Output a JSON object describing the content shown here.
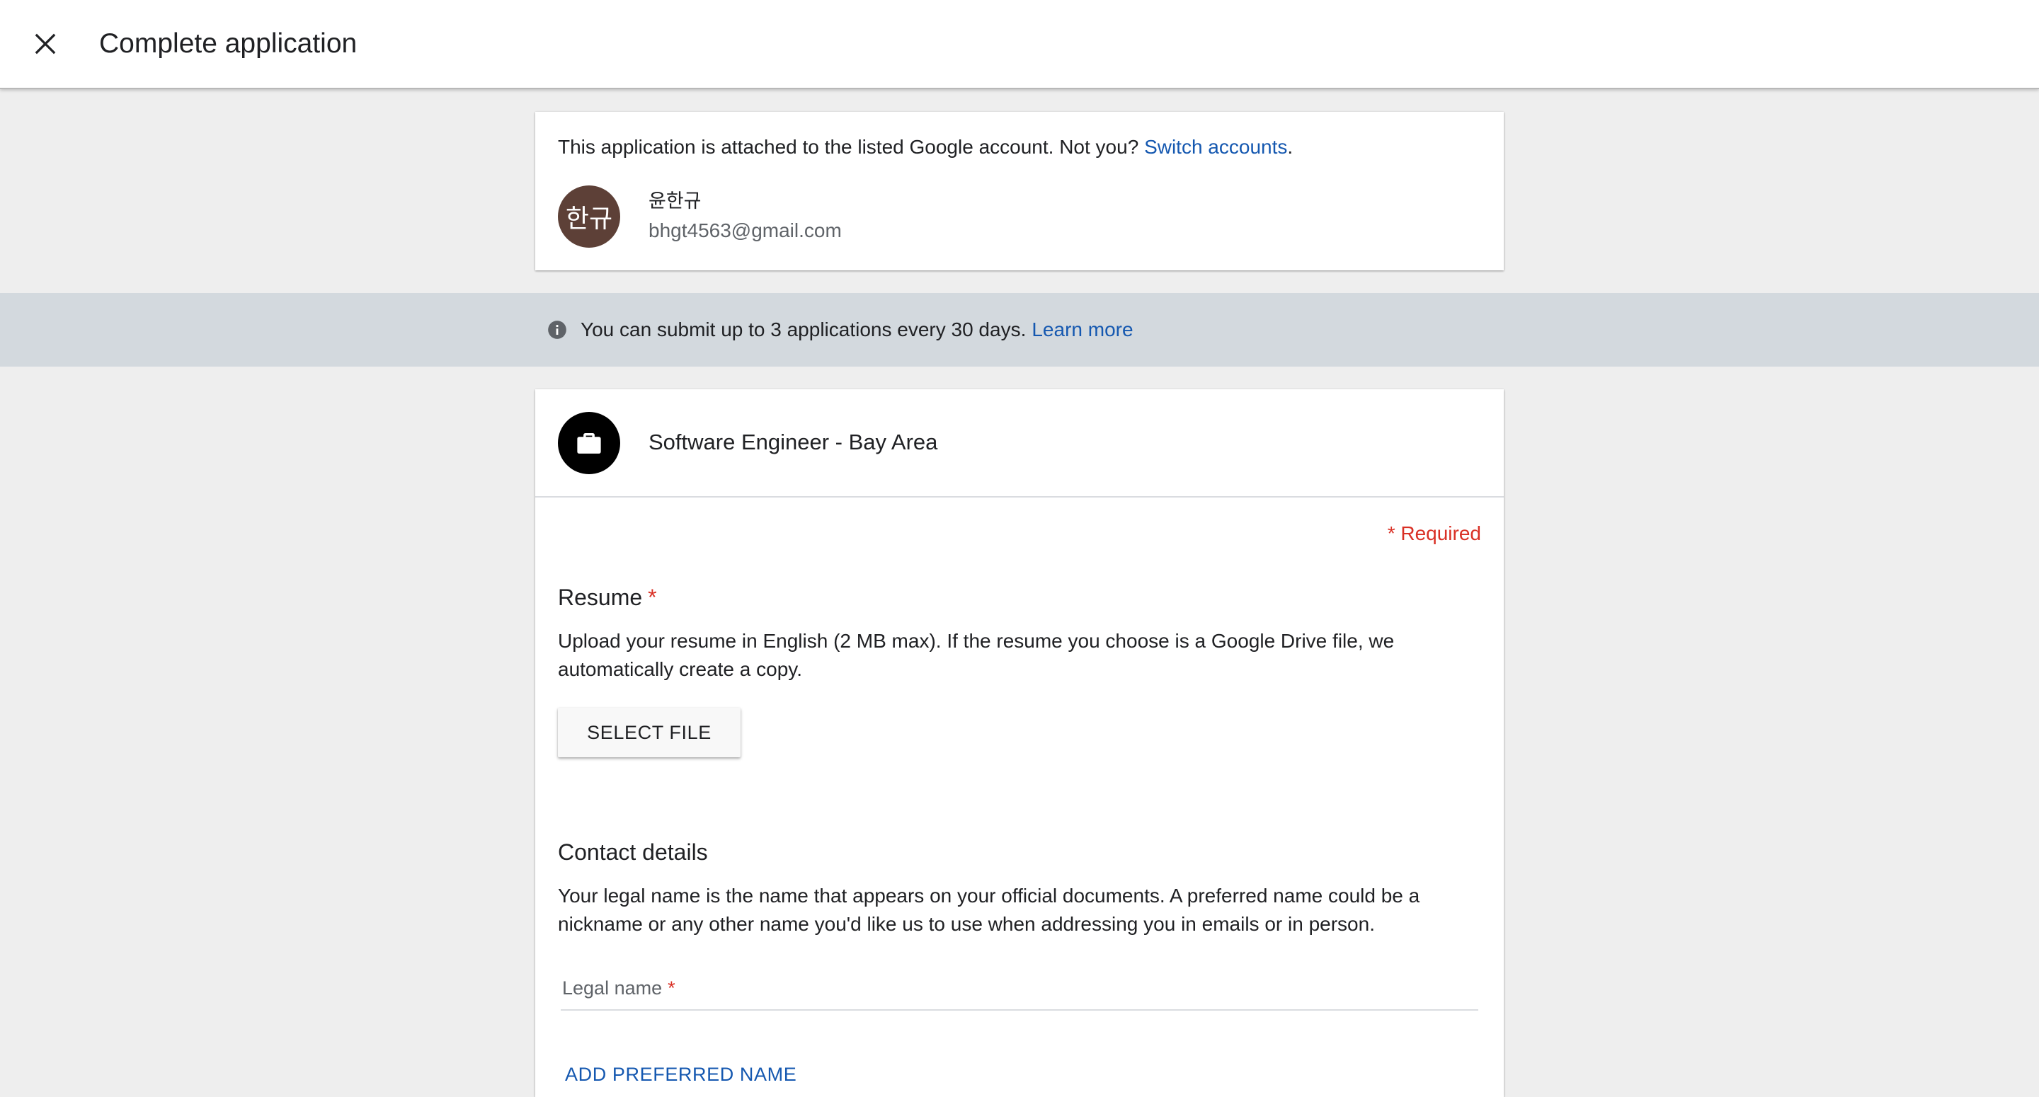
{
  "header": {
    "title": "Complete application",
    "close_icon": "close-icon"
  },
  "account": {
    "message": "This application is attached to the listed Google account. Not you? ",
    "switch_link": "Switch accounts",
    "period": ".",
    "avatar_text": "한규",
    "avatar_color": "#5d4037",
    "name": "윤한규",
    "email": "bhgt4563@gmail.com"
  },
  "info": {
    "icon": "info-icon",
    "message": "You can submit up to 3 applications every 30 days. ",
    "learn_more": "Learn more"
  },
  "job": {
    "icon": "briefcase-icon",
    "title": "Software Engineer - Bay Area"
  },
  "form": {
    "required_note": "* Required",
    "resume": {
      "title": "Resume",
      "star": "*",
      "description": "Upload your resume in English (2 MB max). If the resume you choose is a Google Drive file, we automatically create a copy.",
      "button_label": "SELECT FILE"
    },
    "contact": {
      "title": "Contact details",
      "description": "Your legal name is the name that appears on your official documents. A preferred name could be a nickname or any other name you'd like us to use when addressing you in emails or in person.",
      "legal_name_label": "Legal name",
      "legal_name_star": "*",
      "legal_name_value": "",
      "add_preferred_label": "ADD PREFERRED NAME"
    }
  },
  "colors": {
    "link": "#1558b0",
    "required": "#d93025",
    "info_band": "#d3d9de",
    "page_bg": "#eeeeee"
  }
}
